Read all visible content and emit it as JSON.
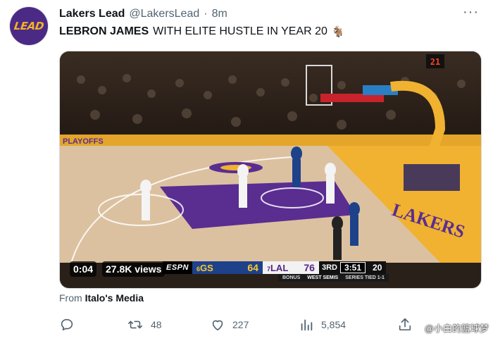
{
  "tweet": {
    "author_name": "Lakers Lead",
    "handle": "@LakersLead",
    "separator": "·",
    "time": "8m",
    "more_label": "···",
    "text_bold": "LEBRON JAMES",
    "text_rest": "WITH ELITE HUSTLE IN YEAR 20",
    "emoji": "🐐",
    "avatar_text": "LEAD"
  },
  "video": {
    "elapsed": "0:04",
    "views": "27.8K views",
    "court_sign": "PLAYOFFS",
    "baseline_text": "LAKERS",
    "shot_clock": "21"
  },
  "scorebug": {
    "network": "ESPN",
    "away_seed": "6",
    "away_team": "GS",
    "away_score": "64",
    "home_seed": "7",
    "home_team": "LAL",
    "home_score": "76",
    "period": "3RD",
    "clock": "3:51",
    "shot_clock": "20",
    "sub_bonus": "BONUS",
    "sub_round": "WEST SEMIS",
    "sub_series": "SERIES TIED 1-1"
  },
  "source": {
    "prefix": "From",
    "name": "Italo's Media"
  },
  "actions": {
    "reply_count": "",
    "retweet_count": "48",
    "like_count": "227",
    "views_count": "5,854"
  },
  "watermark": "@小白的篮球梦",
  "colors": {
    "lakers_purple": "#552583",
    "lakers_gold": "#fdb927",
    "warriors_blue": "#1d428a",
    "warriors_gold": "#ffc72c",
    "muted_text": "#536471"
  }
}
